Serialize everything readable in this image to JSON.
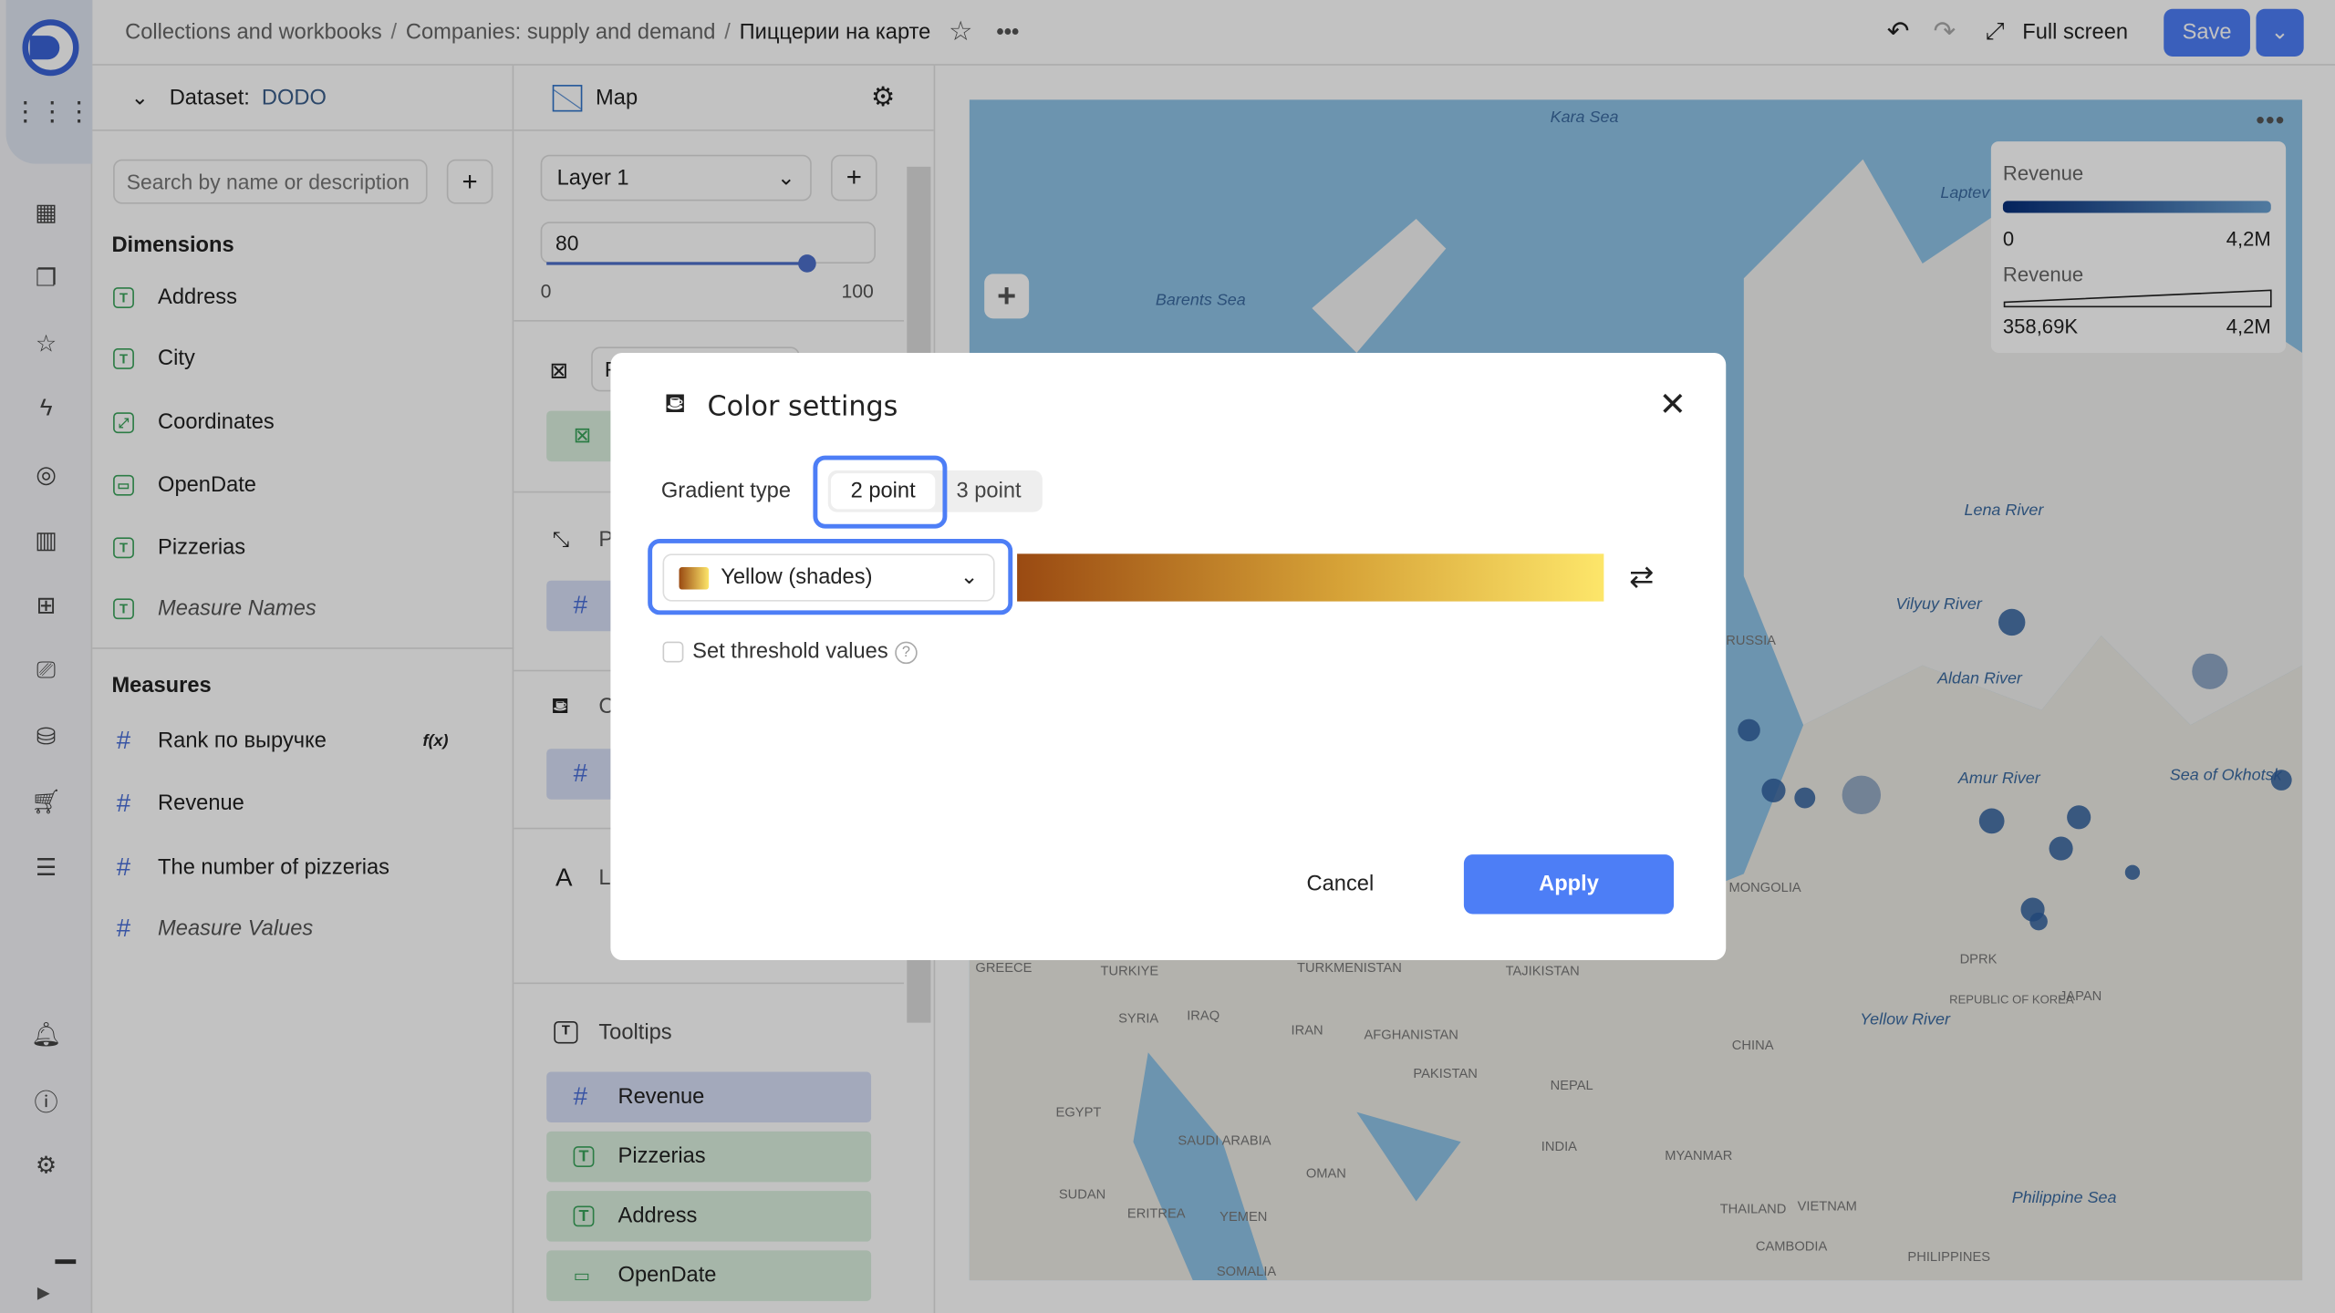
{
  "header": {
    "breadcrumbs": [
      "Collections and workbooks",
      "Companies: supply and demand"
    ],
    "current": "Пиццерии на карте",
    "fullscreen_label": "Full screen",
    "save_label": "Save"
  },
  "rail": {
    "icons": [
      "collections-icon",
      "workbooks-icon",
      "favorites-icon",
      "lightning-icon",
      "datalens-icon",
      "charts-icon",
      "dashboards-icon",
      "monitoring-icon",
      "datasets-icon",
      "cart-icon",
      "settings-sliders-icon"
    ],
    "bottom_icons": [
      "bell-icon",
      "help-icon",
      "gear-icon"
    ]
  },
  "dataset": {
    "label": "Dataset:",
    "name": "DODO",
    "search_placeholder": "Search by name or description",
    "dimensions_title": "Dimensions",
    "dimensions": [
      {
        "name": "Address",
        "type": "text"
      },
      {
        "name": "City",
        "type": "text"
      },
      {
        "name": "Coordinates",
        "type": "geo"
      },
      {
        "name": "OpenDate",
        "type": "date"
      },
      {
        "name": "Pizzerias",
        "type": "text"
      },
      {
        "name": "Measure Names",
        "type": "text",
        "italic": true
      }
    ],
    "measures_title": "Measures",
    "measures": [
      {
        "name": "Rank по выручке",
        "formula": "f(x)"
      },
      {
        "name": "Revenue"
      },
      {
        "name": "The number of pizzerias"
      },
      {
        "name": "Measure Values",
        "italic": true
      }
    ]
  },
  "viz": {
    "title": "Map",
    "layer": "Layer 1",
    "opacity": "80",
    "opacity_value": 80,
    "opacity_min": "0",
    "opacity_max": "100",
    "section_letters": {
      "points": "P",
      "color": "C",
      "labels": "L",
      "points_partial": "F"
    },
    "tooltips_title": "Tooltips",
    "tooltips": [
      {
        "name": "Revenue",
        "kind": "measure"
      },
      {
        "name": "Pizzerias",
        "kind": "text"
      },
      {
        "name": "Address",
        "kind": "text"
      },
      {
        "name": "OpenDate",
        "kind": "date"
      }
    ]
  },
  "map": {
    "legend": {
      "color_title": "Revenue",
      "color_min": "0",
      "color_max": "4,2M",
      "size_title": "Revenue",
      "size_min": "358,69K",
      "size_max": "4,2M"
    },
    "labels": [
      "Kara Sea",
      "Laptev Sea",
      "Barents Sea",
      "Sea of Okhotsk",
      "RUSSIA",
      "MONGOLIA",
      "CHINA",
      "TURKIYE",
      "TURKMENISTAN",
      "TAJIKISTAN",
      "IRAN",
      "IRAQ",
      "SYRIA",
      "AFGHANISTAN",
      "PAKISTAN",
      "NEPAL",
      "INDIA",
      "MYANMAR",
      "THAILAND",
      "VIETNAM",
      "CAMBODIA",
      "EGYPT",
      "SUDAN",
      "ERITREA",
      "YEMEN",
      "SAUDI ARABIA",
      "OMAN",
      "SOMALIA",
      "JAPAN",
      "REPUBLIC OF KOREA",
      "DPRK",
      "Philippine Sea",
      "PHILIPPINES",
      "GREECE",
      "Yellow River",
      "Amur River",
      "Aldan River",
      "Vilyuy River",
      "Lena River"
    ]
  },
  "modal": {
    "title": "Color settings",
    "gradient_type_label": "Gradient type",
    "gradient_options": [
      "2 point",
      "3 point"
    ],
    "selected_option": "2 point",
    "palette": "Yellow (shades)",
    "gradient_colors": [
      "#9a4a12",
      "#d6a237",
      "#fde66a"
    ],
    "threshold_label": "Set threshold values",
    "threshold_checked": false,
    "cancel_label": "Cancel",
    "apply_label": "Apply",
    "accent": "#4d7ef6"
  }
}
